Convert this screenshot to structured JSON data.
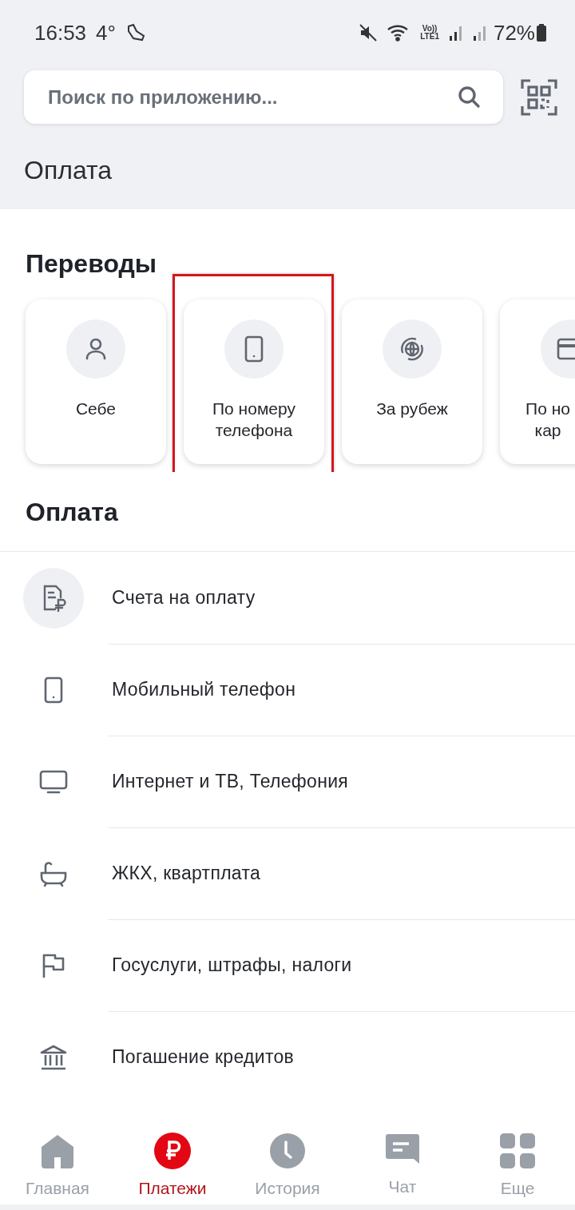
{
  "status_bar": {
    "time": "16:53",
    "temperature": "4°",
    "network_label": [
      "Vo))",
      "LTE1"
    ],
    "battery": "72%"
  },
  "search": {
    "placeholder": "Поиск по приложению..."
  },
  "page_title": "Оплата",
  "transfers": {
    "title": "Переводы",
    "items": [
      {
        "kind": "person",
        "label": "Себе",
        "highlighted": false
      },
      {
        "kind": "phone",
        "label": "По номеру телефона",
        "highlighted": true
      },
      {
        "kind": "globe",
        "label": "За рубеж",
        "highlighted": false
      },
      {
        "kind": "card",
        "label": "По но\nкар",
        "highlighted": false
      }
    ]
  },
  "payments": {
    "title": "Оплата",
    "items": [
      {
        "kind": "invoice",
        "label": "Счета на оплату"
      },
      {
        "kind": "phone",
        "label": "Мобильный телефон"
      },
      {
        "kind": "tv",
        "label": "Интернет и ТВ, Телефония"
      },
      {
        "kind": "bath",
        "label": "ЖКХ, квартплата"
      },
      {
        "kind": "flag",
        "label": "Госуслуги, штрафы, налоги"
      },
      {
        "kind": "bank",
        "label": "Погашение кредитов"
      }
    ]
  },
  "tab_bar": [
    {
      "kind": "home",
      "label": "Главная",
      "selected": false
    },
    {
      "kind": "ruble",
      "label": "Платежи",
      "selected": true
    },
    {
      "kind": "clock",
      "label": "История",
      "selected": false
    },
    {
      "kind": "chat",
      "label": "Чат",
      "selected": false
    },
    {
      "kind": "grid",
      "label": "Еще",
      "selected": false
    }
  ]
}
